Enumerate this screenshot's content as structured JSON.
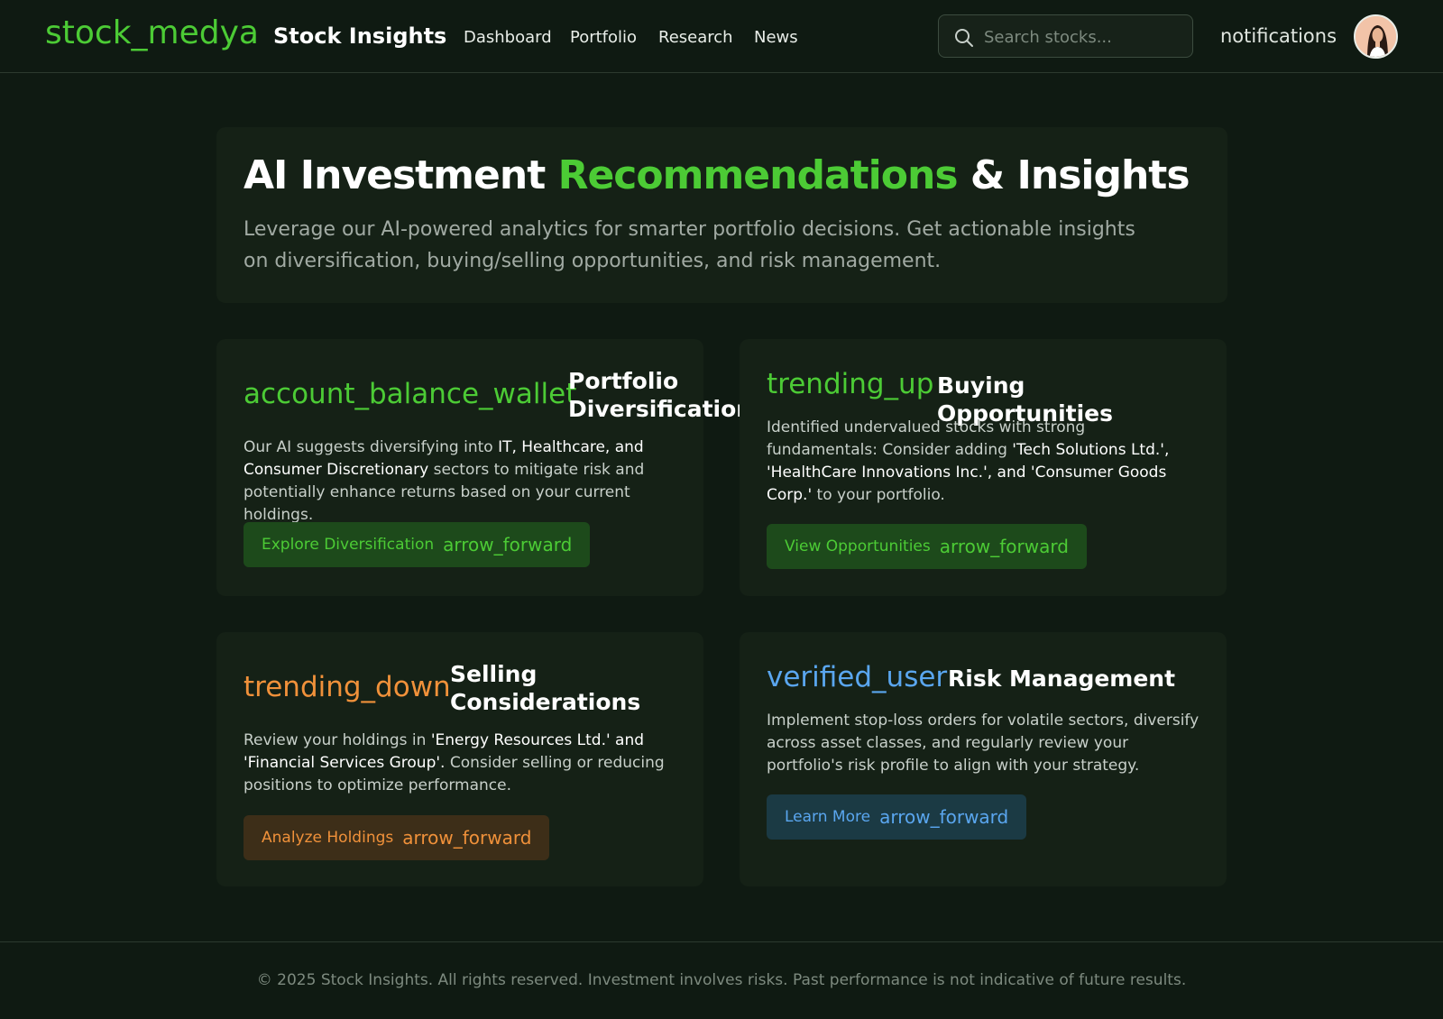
{
  "header": {
    "logo": "stock_medya",
    "brand": "Stock Insights",
    "nav": [
      "Dashboard",
      "Portfolio",
      "Research",
      "News"
    ],
    "search_placeholder": "Search stocks...",
    "notifications": "notifications",
    "avatar_icon": "user-avatar"
  },
  "hero": {
    "title_pre": "AI Investment ",
    "title_accent": "Recommendations",
    "title_post": " & Insights",
    "subtitle": "Leverage our AI-powered analytics for smarter portfolio decisions. Get actionable insights on diversification, buying/selling opportunities, and risk management."
  },
  "cards": [
    {
      "icon": "account_balance_wallet",
      "title": "Portfolio Diversification",
      "desc_pre": "Our AI suggests diversifying into ",
      "desc_bold": "IT, Healthcare, and Consumer Discretionary",
      "desc_post": " sectors to mitigate risk and potentially enhance returns based on your current holdings.",
      "button": "Explore Diversification",
      "button_icon": "arrow_forward",
      "color": "#4ccb35"
    },
    {
      "icon": "trending_up",
      "title": "Buying Opportunities",
      "desc_pre": "Identified undervalued stocks with strong fundamentals: Consider adding ",
      "desc_bold": "'Tech Solutions Ltd.', 'HealthCare Innovations Inc.', and 'Consumer Goods Corp.'",
      "desc_post": " to your portfolio.",
      "button": "View Opportunities",
      "button_icon": "arrow_forward",
      "color": "#4ccb35"
    },
    {
      "icon": "trending_down",
      "title": "Selling Considerations",
      "desc_pre": "Review your holdings in ",
      "desc_bold": "'Energy Resources Ltd.' and 'Financial Services Group'.",
      "desc_post": " Consider selling or reducing positions to optimize performance.",
      "button": "Analyze Holdings",
      "button_icon": "arrow_forward",
      "color": "#f0913a"
    },
    {
      "icon": "verified_user",
      "title": "Risk Management",
      "desc_pre": "Implement stop-loss orders for volatile sectors, diversify across asset classes, and regularly review your portfolio's risk profile to align with your strategy.",
      "desc_bold": "",
      "desc_post": "",
      "button": "Learn More",
      "button_icon": "arrow_forward",
      "color": "#5aa6ef"
    }
  ],
  "footer": {
    "text": "© 2025 Stock Insights. All rights reserved. Investment involves risks. Past performance is not indicative of future results."
  }
}
